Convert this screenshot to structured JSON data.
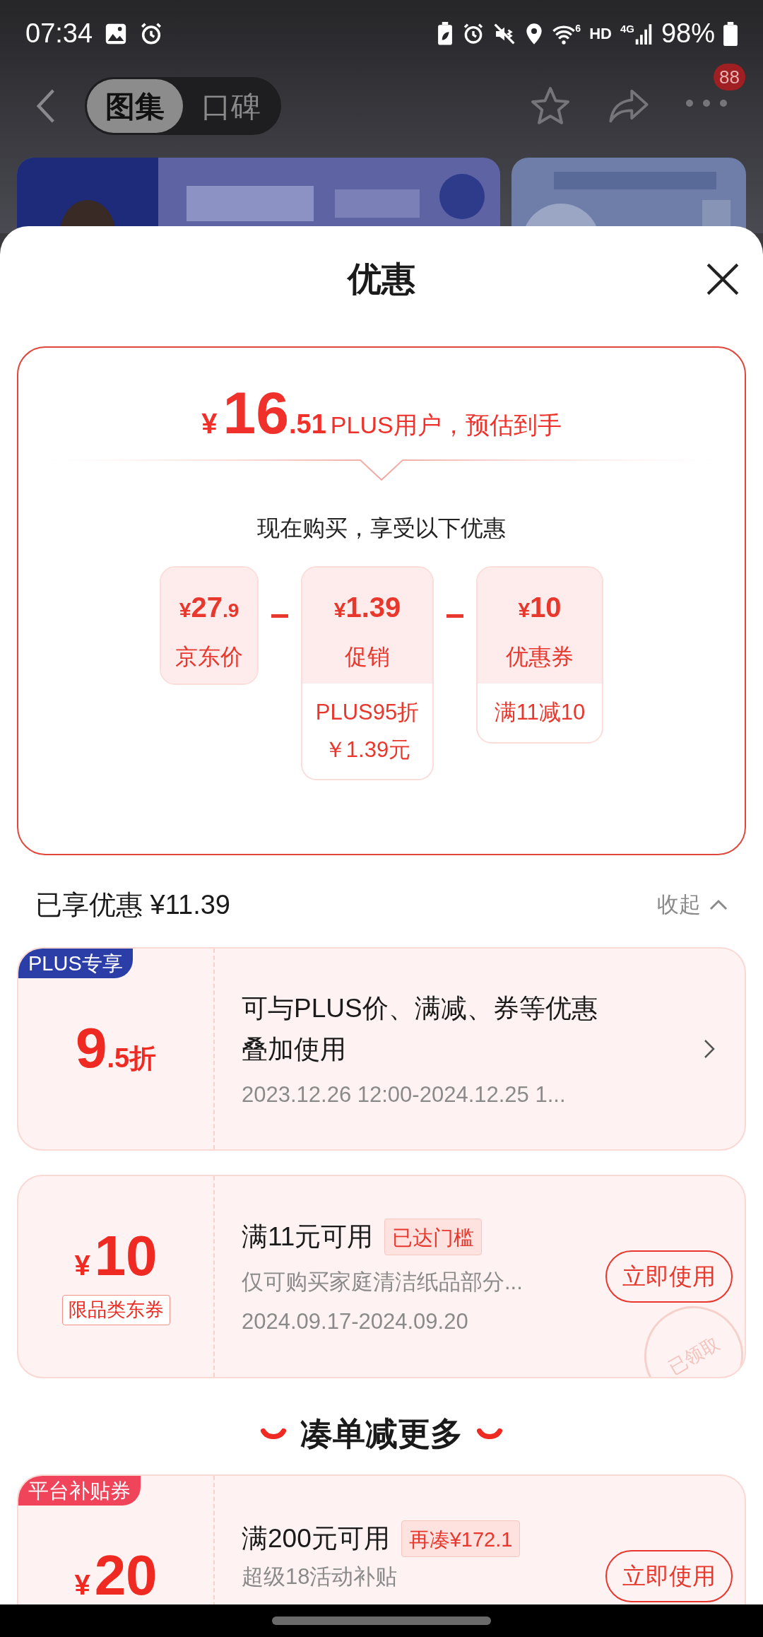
{
  "status_bar": {
    "time": "07:34",
    "wifi_tag": "6",
    "hd": "HD",
    "network": "4G",
    "battery": "98%"
  },
  "header": {
    "tabs": [
      {
        "label": "图集",
        "selected": true
      },
      {
        "label": "口碑",
        "selected": false
      }
    ],
    "badge": "88"
  },
  "sheet": {
    "title": "优惠",
    "estimate": {
      "currency": "¥",
      "integer": "16",
      "decimal": ".51",
      "caption": "PLUS用户，预估到手"
    },
    "breakdown_title": "现在购买，享受以下优惠",
    "breakdown": [
      {
        "currency": "¥",
        "amount": "27",
        "decimal": ".9",
        "label": "京东价"
      },
      {
        "currency": "¥",
        "amount": "1.39",
        "label": "促销",
        "details": [
          "PLUS95折",
          "￥1.39元"
        ]
      },
      {
        "currency": "¥",
        "amount": "10",
        "label": "优惠券",
        "details": [
          "满11减10"
        ]
      }
    ],
    "saved": "已享优惠 ¥11.39",
    "collapse": "收起",
    "coupons": [
      {
        "kind": "discount",
        "tag": "PLUS专享",
        "value": "9",
        "suffix": ".5折",
        "title": "可与PLUS价、满减、券等优惠叠加使用",
        "lines": [
          "2023.12.26 12:00-2024.12.25 1..."
        ]
      },
      {
        "kind": "coupon",
        "currency": "¥",
        "value": "10",
        "sub_tag": "限品类东券",
        "title": "满11元可用",
        "badge": "已达门槛",
        "lines": [
          "仅可购买家庭清洁纸品部分...",
          "2024.09.17-2024.09.20"
        ],
        "button": "立即使用",
        "stamp": "已领取"
      }
    ],
    "more_title": "凑单减更多",
    "more_coupons": [
      {
        "kind": "coupon",
        "tag": "平台补贴券",
        "currency": "¥",
        "value": "20",
        "title": "满200元可用",
        "badge": "再凑¥172.1",
        "lines": [
          "超级18活动补贴"
        ],
        "button": "立即使用"
      }
    ]
  }
}
